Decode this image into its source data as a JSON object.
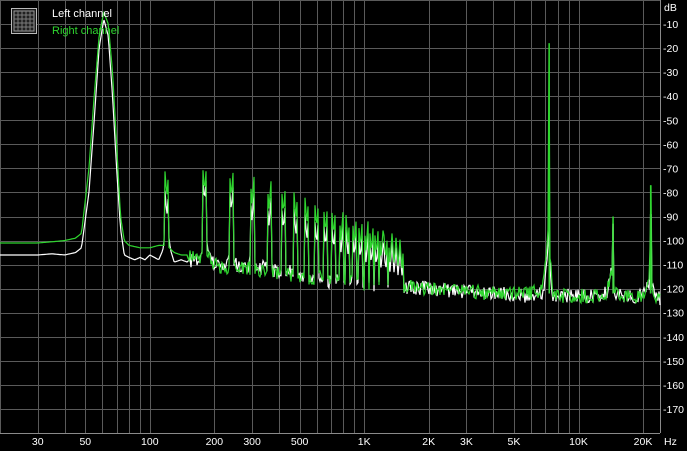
{
  "chart_data": {
    "type": "line",
    "xscale": "log",
    "xlim": [
      20,
      24000
    ],
    "ylim": [
      -180,
      0
    ],
    "grid": true,
    "legend_position": "top-left",
    "y_unit": "dB",
    "x_unit": "Hz",
    "xlabel": "",
    "ylabel": "",
    "y_ticks": [
      -10,
      -20,
      -30,
      -40,
      -50,
      -60,
      -70,
      -80,
      -90,
      -100,
      -110,
      -120,
      -130,
      -140,
      -150,
      -160,
      -170
    ],
    "x_ticks": [
      {
        "value": 30,
        "label": "30"
      },
      {
        "value": 50,
        "label": "50"
      },
      {
        "value": 100,
        "label": "100"
      },
      {
        "value": 200,
        "label": "200"
      },
      {
        "value": 300,
        "label": "300"
      },
      {
        "value": 500,
        "label": "500"
      },
      {
        "value": 1000,
        "label": "1K"
      },
      {
        "value": 2000,
        "label": "2K"
      },
      {
        "value": 3000,
        "label": "3K"
      },
      {
        "value": 5000,
        "label": "5K"
      },
      {
        "value": 10000,
        "label": "10K"
      },
      {
        "value": 20000,
        "label": "20K"
      }
    ],
    "series": [
      {
        "name": "Left channel",
        "color": "#ffffff",
        "points": [
          [
            20,
            -106
          ],
          [
            25,
            -106
          ],
          [
            30,
            -106
          ],
          [
            35,
            -105.5
          ],
          [
            40,
            -106
          ],
          [
            45,
            -105
          ],
          [
            48,
            -103
          ],
          [
            52,
            -80
          ],
          [
            55,
            -50
          ],
          [
            58,
            -20
          ],
          [
            61,
            -8
          ],
          [
            64,
            -15
          ],
          [
            67,
            -40
          ],
          [
            70,
            -70
          ],
          [
            73,
            -95
          ],
          [
            76,
            -106
          ],
          [
            80,
            -107
          ],
          [
            85,
            -108
          ],
          [
            90,
            -107
          ],
          [
            95,
            -108
          ],
          [
            100,
            -106
          ],
          [
            105,
            -107
          ],
          [
            110,
            -108
          ],
          [
            115,
            -104
          ],
          [
            120,
            -92
          ],
          [
            125,
            -104
          ],
          [
            130,
            -109
          ],
          [
            140,
            -108
          ],
          [
            150,
            -109
          ],
          [
            160,
            -108
          ],
          [
            170,
            -110
          ],
          [
            180,
            -105
          ],
          [
            185,
            -100
          ],
          [
            190,
            -104
          ],
          [
            200,
            -110
          ],
          [
            220,
            -111
          ],
          [
            240,
            -106
          ],
          [
            250,
            -110
          ],
          [
            280,
            -112
          ],
          [
            300,
            -108
          ],
          [
            320,
            -113
          ],
          [
            350,
            -110
          ],
          [
            400,
            -114
          ],
          [
            450,
            -113
          ],
          [
            500,
            -116
          ],
          [
            600,
            -116
          ],
          [
            700,
            -117
          ],
          [
            800,
            -117
          ],
          [
            1000,
            -118
          ],
          [
            1500,
            -119
          ],
          [
            2000,
            -120
          ],
          [
            2500,
            -121
          ],
          [
            3000,
            -121.5
          ],
          [
            4000,
            -122
          ],
          [
            5000,
            -122.5
          ],
          [
            6000,
            -123
          ],
          [
            6800,
            -122
          ],
          [
            7100,
            -112
          ],
          [
            7250,
            -100
          ],
          [
            7350,
            -112
          ],
          [
            7600,
            -123
          ],
          [
            8000,
            -123
          ],
          [
            10000,
            -123
          ],
          [
            12000,
            -123
          ],
          [
            13500,
            -122
          ],
          [
            14300,
            -112
          ],
          [
            14600,
            -122
          ],
          [
            16000,
            -123
          ],
          [
            18000,
            -123
          ],
          [
            20000,
            -123
          ],
          [
            21300,
            -118
          ],
          [
            21700,
            -108
          ],
          [
            22000,
            -120
          ],
          [
            23000,
            -123
          ],
          [
            24000,
            -124
          ]
        ],
        "peaks": [
          [
            7300,
            -84
          ],
          [
            14500,
            -93
          ],
          [
            21700,
            -89
          ]
        ]
      },
      {
        "name": "Right channel",
        "color": "#2fd62f",
        "points": [
          [
            20,
            -101
          ],
          [
            25,
            -101
          ],
          [
            30,
            -101
          ],
          [
            35,
            -100.5
          ],
          [
            40,
            -100
          ],
          [
            45,
            -99
          ],
          [
            48,
            -97
          ],
          [
            52,
            -70
          ],
          [
            55,
            -40
          ],
          [
            58,
            -15
          ],
          [
            61,
            -5
          ],
          [
            64,
            -10
          ],
          [
            67,
            -30
          ],
          [
            70,
            -60
          ],
          [
            73,
            -90
          ],
          [
            76,
            -100
          ],
          [
            80,
            -102
          ],
          [
            90,
            -103
          ],
          [
            100,
            -103
          ],
          [
            110,
            -102
          ],
          [
            120,
            -102
          ],
          [
            130,
            -105
          ],
          [
            140,
            -106
          ],
          [
            150,
            -106
          ],
          [
            160,
            -107
          ],
          [
            170,
            -108
          ],
          [
            180,
            -105
          ],
          [
            200,
            -110
          ],
          [
            220,
            -111
          ],
          [
            250,
            -111
          ],
          [
            300,
            -112
          ],
          [
            400,
            -114
          ],
          [
            500,
            -115
          ],
          [
            700,
            -116
          ],
          [
            1000,
            -118
          ],
          [
            1500,
            -119
          ],
          [
            2000,
            -120
          ],
          [
            3000,
            -121
          ],
          [
            4000,
            -122
          ],
          [
            5000,
            -122
          ],
          [
            6000,
            -122
          ],
          [
            6800,
            -120
          ],
          [
            7100,
            -105
          ],
          [
            7250,
            -90
          ],
          [
            7350,
            -106
          ],
          [
            7600,
            -122
          ],
          [
            8000,
            -123
          ],
          [
            10000,
            -123
          ],
          [
            12000,
            -123
          ],
          [
            13500,
            -122
          ],
          [
            14300,
            -112
          ],
          [
            14600,
            -122
          ],
          [
            16000,
            -123
          ],
          [
            20000,
            -123
          ],
          [
            21300,
            -118
          ],
          [
            21700,
            -100
          ],
          [
            22000,
            -120
          ],
          [
            23000,
            -123
          ],
          [
            24000,
            -124
          ]
        ],
        "peaks": [
          [
            7300,
            -18
          ],
          [
            14500,
            -90
          ],
          [
            21700,
            -77
          ]
        ]
      }
    ],
    "harmonics": {
      "fundamental_hz": 60,
      "left_levels": [
        -90,
        -84,
        -88,
        -92,
        -94,
        -96,
        -98,
        -100,
        -102,
        -103,
        -104,
        -105,
        -106,
        -107,
        -108,
        -109,
        -110,
        -111,
        -112,
        -113,
        -113,
        -114,
        -115,
        -115
      ],
      "right_levels": [
        -82,
        -80,
        -82,
        -85,
        -87,
        -89,
        -91,
        -93,
        -95,
        -97,
        -98,
        -100,
        -101,
        -102,
        -103,
        -104,
        -105,
        -106,
        -107,
        -108,
        -109,
        -110,
        -111,
        -112
      ]
    }
  },
  "legend": {
    "items": [
      {
        "label": "Left channel",
        "color": "#ffffff"
      },
      {
        "label": "Right channel",
        "color": "#2fd62f"
      }
    ]
  },
  "axis_units": {
    "y": "dB",
    "x": "Hz"
  }
}
